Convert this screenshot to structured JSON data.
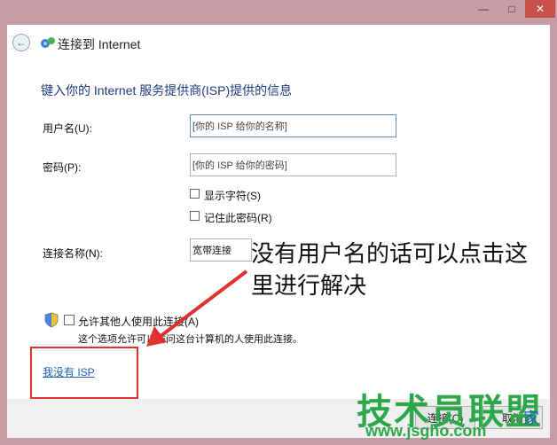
{
  "window": {
    "title": "连接到 Internet"
  },
  "window_controls": {
    "minimize": "—",
    "maximize": "□",
    "close": "✕"
  },
  "form": {
    "heading": "键入你的 Internet 服务提供商(ISP)提供的信息",
    "username_label": "用户名(U):",
    "username_placeholder": "[你的 ISP 给你的名称]",
    "password_label": "密码(P):",
    "password_placeholder": "[你的 ISP 给你的密码]",
    "show_chars": "显示字符(S)",
    "remember_password": "记住此密码(R)",
    "conn_name_label": "连接名称(N):",
    "conn_name_value": "宽带连接",
    "allow_others": "允许其他人使用此连接(A)",
    "allow_others_desc": "这个选项允许可以访问这台计算机的人使用此连接。",
    "no_isp_link": "我没有 ISP"
  },
  "annotation": {
    "text": "没有用户名的话可以点击这里进行解决"
  },
  "footer": {
    "connect": "连接(C)",
    "cancel": "取消"
  },
  "watermark": {
    "title": "技术员联盟",
    "url": "www.jsgho.com",
    "home": "家"
  }
}
